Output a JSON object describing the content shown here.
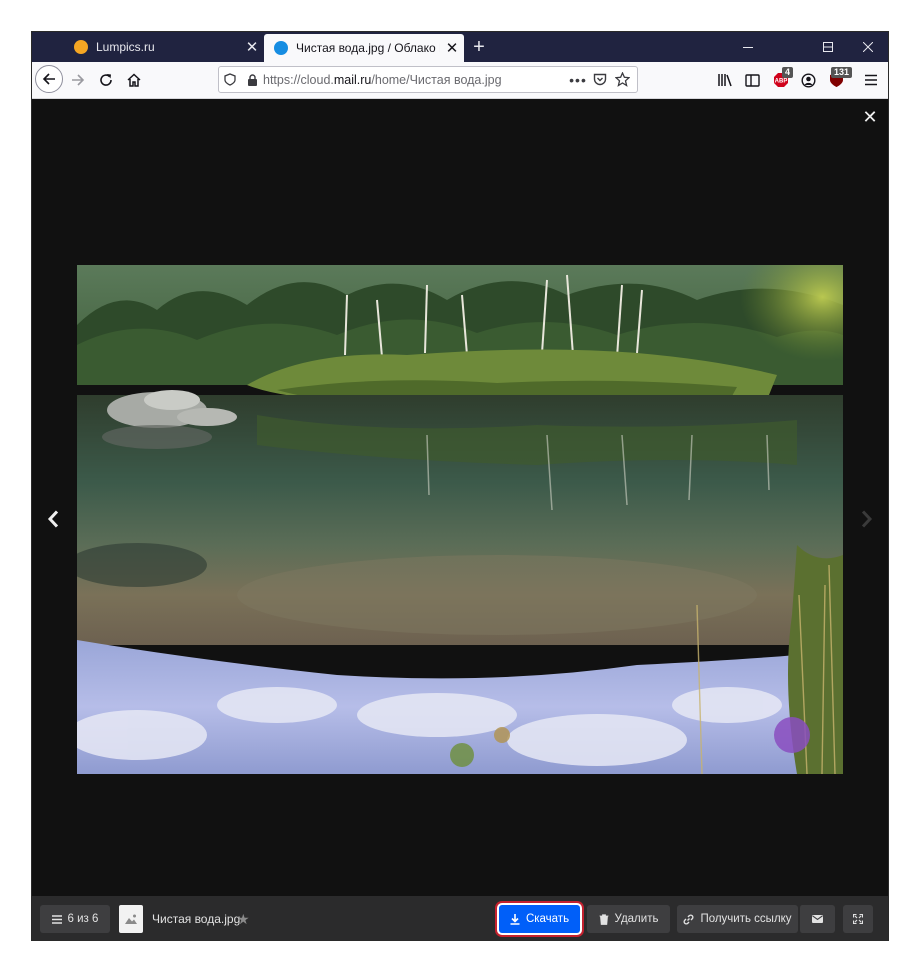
{
  "browser": {
    "tabs": [
      {
        "title": "Lumpics.ru",
        "active": false,
        "favicon_color": "#f5a623"
      },
      {
        "title": "Чистая вода.jpg / Облако Mail",
        "active": true,
        "favicon_color": "#168de2"
      }
    ],
    "new_tab_label": "+",
    "url_plain_prefix": "https://cloud.",
    "url_domain": "mail.ru",
    "url_path": "/home/Чистая вода.jpg",
    "extensions": [
      {
        "name": "adblock-icon",
        "badge": "4"
      },
      {
        "name": "ublock-icon",
        "badge": "131"
      }
    ]
  },
  "viewer": {
    "counter": "6 из 6",
    "file_name": "Чистая вода.jpg",
    "buttons": {
      "download": "Скачать",
      "delete": "Удалить",
      "get_link": "Получить ссылку"
    }
  },
  "colors": {
    "primary": "#005ff9",
    "highlight": "#c4212f",
    "viewer_bg": "#111111",
    "toolbar_bg": "#2b2b2c"
  }
}
